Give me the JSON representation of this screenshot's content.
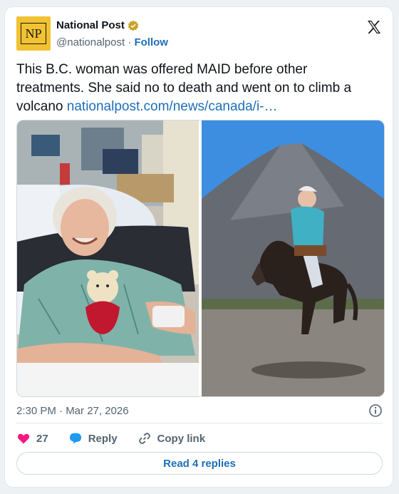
{
  "account": {
    "display_name": "National Post",
    "avatar_text": "NP",
    "handle": "@nationalpost",
    "separator": "·",
    "follow_label": "Follow"
  },
  "post": {
    "text": "This B.C. woman was offered MAID before other treatments. She said no to death and went on to climb a volcano ",
    "link_text": "nationalpost.com/news/canada/i-…"
  },
  "meta": {
    "timestamp": "2:30 PM · Mar 27, 2026"
  },
  "actions": {
    "like_count": "27",
    "reply_label": "Reply",
    "copy_label": "Copy link"
  },
  "footer": {
    "read_replies_label": "Read 4 replies"
  },
  "colors": {
    "link": "#1d6fb8",
    "like": "#f91880",
    "reply": "#1d9bf0",
    "avatar_bg": "#f1c232"
  },
  "icons": [
    "verified-badge-icon",
    "x-logo-icon",
    "info-icon",
    "heart-icon",
    "reply-bubble-icon",
    "link-icon"
  ]
}
